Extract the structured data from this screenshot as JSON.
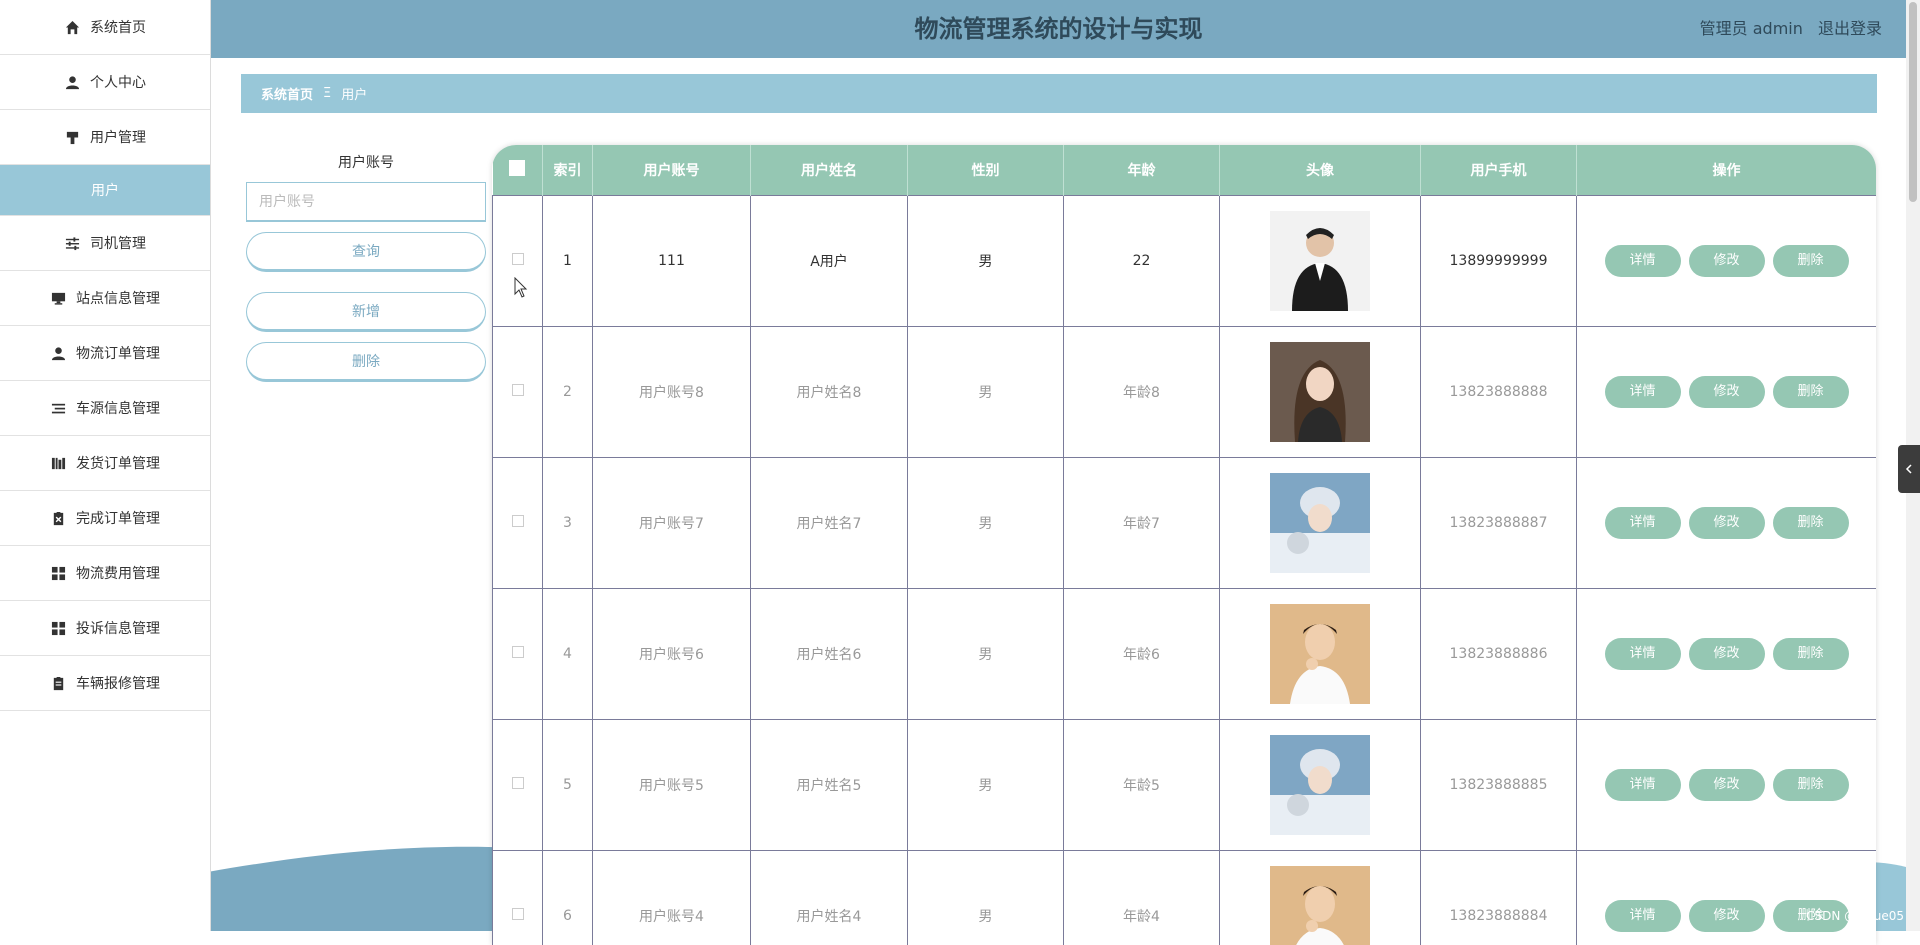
{
  "header": {
    "title": "物流管理系统的设计与实现",
    "user_label": "管理员 admin",
    "logout_label": "退出登录"
  },
  "breadcrumb": {
    "home": "系统首页",
    "separator": "Ξ",
    "current": "用户"
  },
  "sidebar": {
    "items": [
      {
        "label": "系统首页",
        "icon": "home-icon"
      },
      {
        "label": "个人中心",
        "icon": "person-icon"
      },
      {
        "label": "用户管理",
        "icon": "user-manage-icon"
      },
      {
        "label": "用户",
        "icon": ""
      },
      {
        "label": "司机管理",
        "icon": "sliders-icon"
      },
      {
        "label": "站点信息管理",
        "icon": "monitor-icon"
      },
      {
        "label": "物流订单管理",
        "icon": "person-icon"
      },
      {
        "label": "车源信息管理",
        "icon": "list-icon"
      },
      {
        "label": "发货订单管理",
        "icon": "bars-icon"
      },
      {
        "label": "完成订单管理",
        "icon": "clipboard-x-icon"
      },
      {
        "label": "物流费用管理",
        "icon": "grid-icon"
      },
      {
        "label": "投诉信息管理",
        "icon": "grid-icon"
      },
      {
        "label": "车辆报修管理",
        "icon": "clipboard-icon"
      }
    ]
  },
  "search": {
    "label": "用户账号",
    "placeholder": "用户账号",
    "query_label": "查询",
    "add_label": "新增",
    "delete_label": "删除"
  },
  "table": {
    "headers": [
      "索引",
      "用户账号",
      "用户姓名",
      "性别",
      "年龄",
      "头像",
      "用户手机",
      "操作"
    ],
    "rows": [
      {
        "index": "1",
        "account": "111",
        "name": "A用户",
        "gender": "男",
        "age": "22",
        "phone": "13899999999"
      },
      {
        "index": "2",
        "account": "用户账号8",
        "name": "用户姓名8",
        "gender": "男",
        "age": "年龄8",
        "phone": "13823888888"
      },
      {
        "index": "3",
        "account": "用户账号7",
        "name": "用户姓名7",
        "gender": "男",
        "age": "年龄7",
        "phone": "13823888887"
      },
      {
        "index": "4",
        "account": "用户账号6",
        "name": "用户姓名6",
        "gender": "男",
        "age": "年龄6",
        "phone": "13823888886"
      },
      {
        "index": "5",
        "account": "用户账号5",
        "name": "用户姓名5",
        "gender": "男",
        "age": "年龄5",
        "phone": "13823888885"
      },
      {
        "index": "6",
        "account": "用户账号4",
        "name": "用户姓名4",
        "gender": "男",
        "age": "年龄4",
        "phone": "13823888884"
      }
    ],
    "actions": {
      "detail": "详情",
      "edit": "修改",
      "delete": "删除"
    }
  },
  "watermark": "CSDN @yiyue05",
  "colors": {
    "header": "#7aa9c1",
    "breadcrumb": "#98c7d8",
    "table_head": "#95c7b3",
    "active_sidebar": "#98c7d8"
  }
}
